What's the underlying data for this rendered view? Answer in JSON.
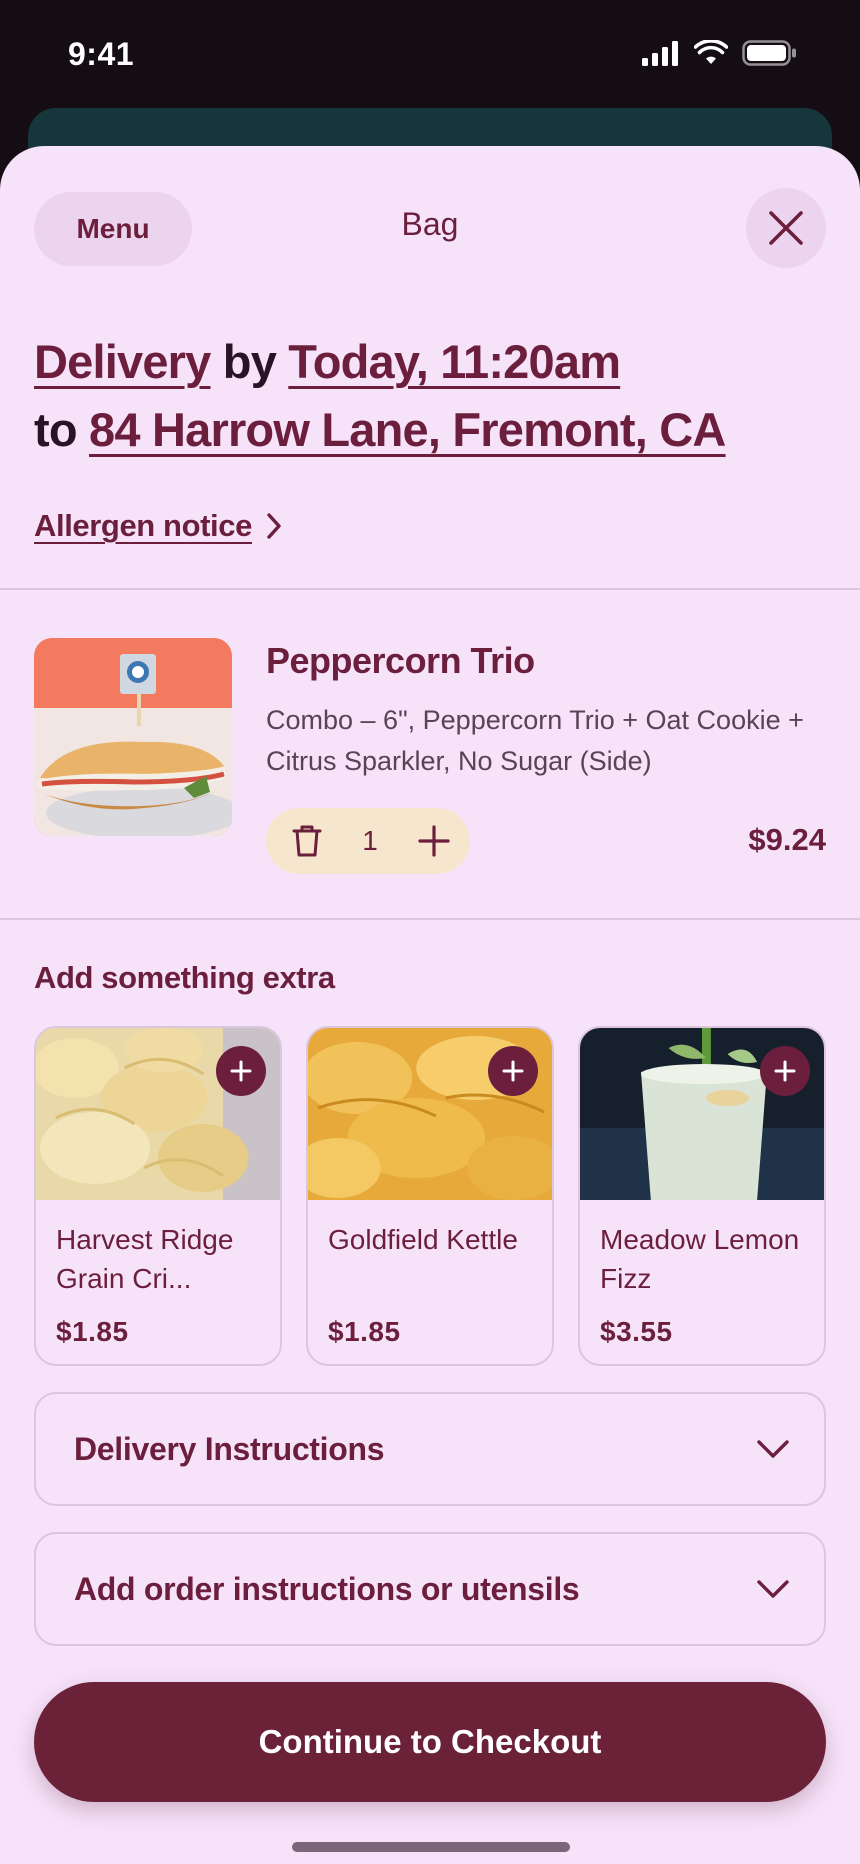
{
  "status_bar": {
    "time": "9:41"
  },
  "header": {
    "menu_label": "Menu",
    "title": "Bag"
  },
  "delivery": {
    "mode": "Delivery",
    "by": "by",
    "time": "Today, 11:20am",
    "to": "to",
    "address": "84 Harrow Lane, Fremont, CA"
  },
  "allergen_label": "Allergen notice",
  "cart_item": {
    "name": "Peppercorn Trio",
    "description": "Combo – 6\", Peppercorn Trio + Oat Cookie + Citrus Sparkler, No Sugar (Side)",
    "quantity": "1",
    "price": "$9.24"
  },
  "extras": {
    "title": "Add something extra",
    "items": [
      {
        "name": "Harvest Ridge Grain Cri...",
        "price": "$1.85"
      },
      {
        "name": "Goldfield Kettle",
        "price": "$1.85"
      },
      {
        "name": "Meadow Lemon Fizz",
        "price": "$3.55"
      }
    ]
  },
  "accordions": [
    {
      "label": "Delivery Instructions"
    },
    {
      "label": "Add order instructions or utensils"
    }
  ],
  "checkout_label": "Continue to Checkout",
  "colors": {
    "accent": "#6b1f3c",
    "sheet_bg": "#f6e3fa",
    "stepper_bg": "#f5e6cd",
    "checkout_bg": "#6b2238"
  }
}
